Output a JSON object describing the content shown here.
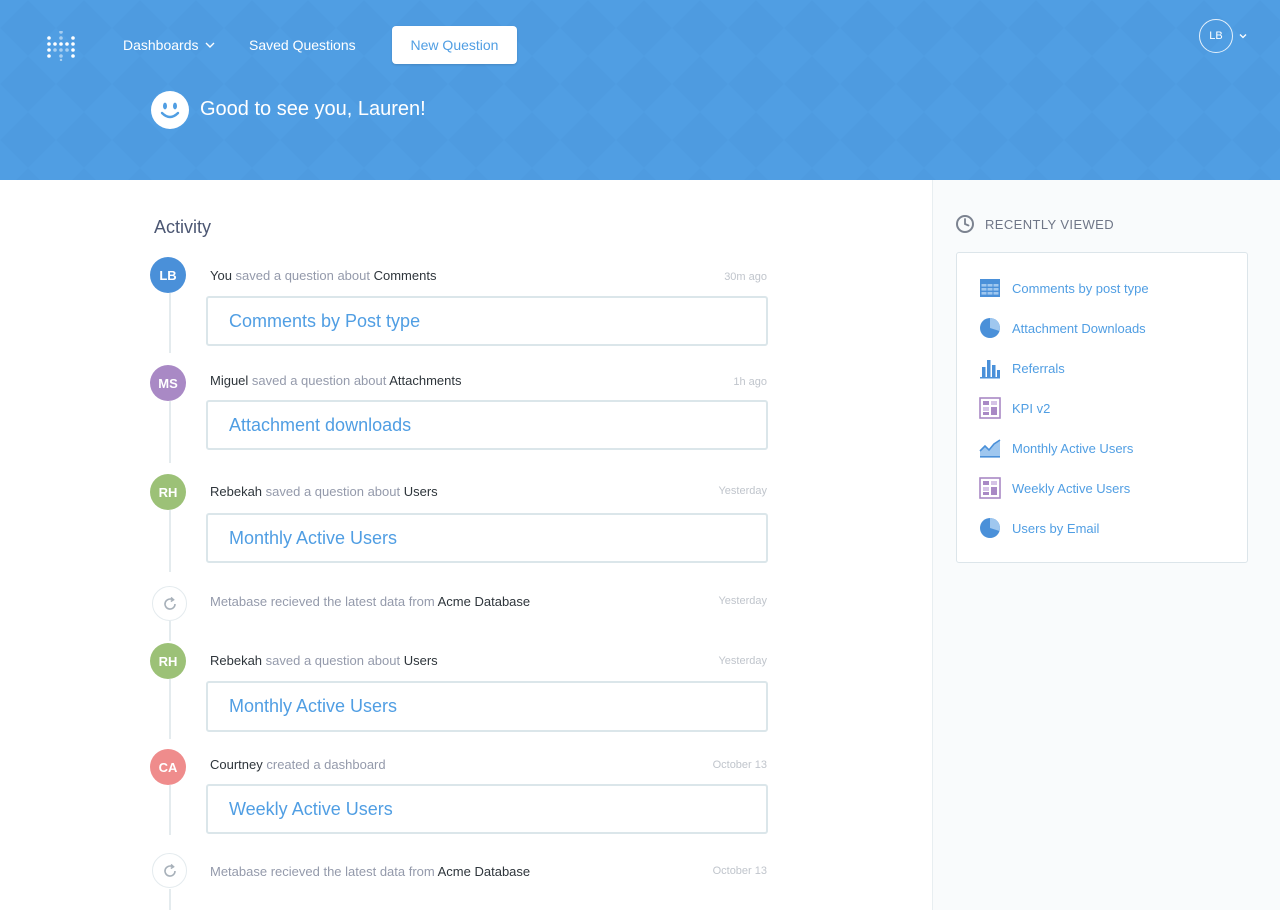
{
  "nav": {
    "dashboards_label": "Dashboards",
    "saved_questions_label": "Saved Questions",
    "new_question_label": "New Question",
    "user_initials": "LB"
  },
  "header": {
    "greeting": "Good to see you, Lauren!",
    "background_color": "#509ee3"
  },
  "activity": {
    "title": "Activity",
    "items": [
      {
        "kind": "question",
        "initials": "LB",
        "avatar_color": "#4a90d9",
        "actor": "You",
        "verb": " saved a question about ",
        "object": "Comments",
        "time": "30m ago",
        "card_title": "Comments by Post type"
      },
      {
        "kind": "question",
        "initials": "MS",
        "avatar_color": "#a989c5",
        "actor": "Miguel",
        "verb": " saved a question about ",
        "object": "Attachments",
        "time": "1h ago",
        "card_title": "Attachment downloads"
      },
      {
        "kind": "question",
        "initials": "RH",
        "avatar_color": "#9cc177",
        "actor": "Rebekah",
        "verb": " saved a question about ",
        "object": "Users",
        "time": "Yesterday",
        "card_title": "Monthly Active Users"
      },
      {
        "kind": "sync",
        "icon": "sync-icon",
        "text": "Metabase recieved the latest data from ",
        "object": "Acme Database",
        "time": "Yesterday"
      },
      {
        "kind": "question",
        "initials": "RH",
        "avatar_color": "#9cc177",
        "actor": "Rebekah",
        "verb": " saved a question about ",
        "object": "Users",
        "time": "Yesterday",
        "card_title": "Monthly Active Users"
      },
      {
        "kind": "dashboard",
        "initials": "CA",
        "avatar_color": "#ef8c8c",
        "actor": "Courtney",
        "verb": " created a dashboard",
        "time": "October 13",
        "card_title": "Weekly Active Users"
      },
      {
        "kind": "sync",
        "icon": "sync-icon",
        "text": "Metabase recieved the latest data from ",
        "object": "Acme Database",
        "time": "October 13"
      }
    ]
  },
  "recently_viewed": {
    "title": "RECENTLY VIEWED",
    "icon": "clock-icon",
    "items": [
      {
        "label": "Comments by post type",
        "icon": "table-icon"
      },
      {
        "label": "Attachment Downloads",
        "icon": "pie-chart-icon"
      },
      {
        "label": "Referrals",
        "icon": "bar-chart-icon"
      },
      {
        "label": "KPI v2",
        "icon": "dashboard-icon"
      },
      {
        "label": "Monthly Active Users",
        "icon": "area-chart-icon"
      },
      {
        "label": "Weekly Active Users",
        "icon": "dashboard-icon"
      },
      {
        "label": "Users by Email",
        "icon": "pie-chart-icon"
      }
    ]
  }
}
